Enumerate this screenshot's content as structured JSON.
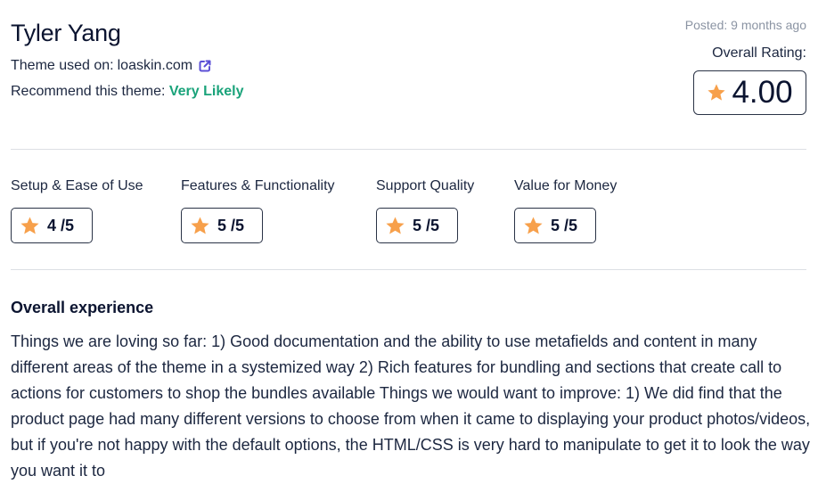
{
  "review": {
    "reviewer_name": "Tyler Yang",
    "theme_used_label": "Theme used on: ",
    "theme_used_site": "loaskin.com",
    "external_link_icon": "external-link-icon",
    "recommend_label": "Recommend this theme: ",
    "recommend_value": "Very Likely",
    "posted": "Posted: 9 months ago",
    "overall_rating_label": "Overall Rating:",
    "overall_rating_value": "4.00",
    "star_icon": "star-icon"
  },
  "criteria": [
    {
      "label": "Setup & Ease of Use",
      "score": "4 /5"
    },
    {
      "label": "Features & Functionality",
      "score": "5 /5"
    },
    {
      "label": "Support Quality",
      "score": "5 /5"
    },
    {
      "label": "Value for Money",
      "score": "5 /5"
    }
  ],
  "experience": {
    "title": "Overall experience",
    "body": "Things we are loving so far: 1) Good documentation and the ability to use metafields and content in many different areas of the theme in a systemized way 2) Rich features for bundling and sections that create call to actions for customers to shop the bundles available Things we would want to improve: 1) We did find that the product page had many different versions to choose from when it came to displaying your product photos/videos, but if you're not happy with the default options, the HTML/CSS is very hard to manipulate to get it to look the way you want it to"
  },
  "colors": {
    "accent_green": "#1aa37a",
    "star_orange": "#f7a04b",
    "link_icon_purple": "#5b4fd6"
  }
}
